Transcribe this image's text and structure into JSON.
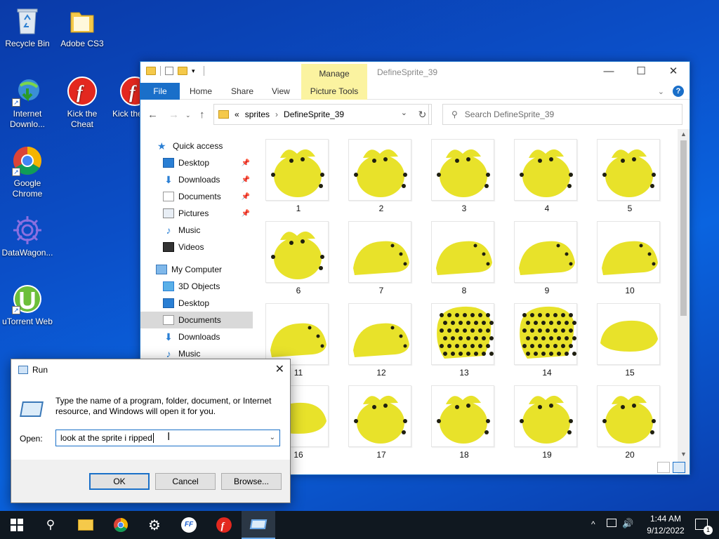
{
  "desktop": {
    "icons": [
      {
        "label": "Recycle Bin",
        "icon": "recycle-bin-icon"
      },
      {
        "label": "Adobe CS3",
        "icon": "folder-icon"
      },
      {
        "label": "Internet Downlo...",
        "icon": "internet-download-manager-icon"
      },
      {
        "label": "Kick the Cheat",
        "icon": "flash-icon"
      },
      {
        "label": "Kick the Cheat_d...",
        "icon": "flash-icon"
      },
      {
        "label": "Google Chrome",
        "icon": "chrome-icon"
      },
      {
        "label": "DataWagon...",
        "icon": "datawagon-icon"
      },
      {
        "label": "uTorrent Web",
        "icon": "utorrent-icon"
      }
    ]
  },
  "explorer": {
    "title": "DefineSprite_39",
    "manage_label": "Manage",
    "tabs": {
      "file": "File",
      "home": "Home",
      "share": "Share",
      "view": "View",
      "picture_tools": "Picture Tools"
    },
    "address": {
      "prefix": "«",
      "segments": [
        "sprites",
        "DefineSprite_39"
      ],
      "sep": "›"
    },
    "search_placeholder": "Search DefineSprite_39",
    "nav": {
      "quick_access": "Quick access",
      "quick_items": [
        "Desktop",
        "Downloads",
        "Documents",
        "Pictures",
        "Music",
        "Videos"
      ],
      "my_computer": "My Computer",
      "pc_items": [
        "3D Objects",
        "Desktop",
        "Documents",
        "Downloads",
        "Music"
      ]
    },
    "files": [
      "1",
      "2",
      "3",
      "4",
      "5",
      "6",
      "7",
      "8",
      "9",
      "10",
      "11",
      "12",
      "13",
      "14",
      "15",
      "16",
      "17",
      "18",
      "19",
      "20"
    ],
    "colors": {
      "file_tab": "#1a6fc9",
      "contextual": "#fbf3a0",
      "sprite": "#e8e22a",
      "sprite_dark": "#1f1f10"
    }
  },
  "run": {
    "title": "Run",
    "description": "Type the name of a program, folder, document, or Internet resource, and Windows will open it for you.",
    "open_label": "Open:",
    "input_value": "look at the sprite i ripped",
    "ok": "OK",
    "cancel": "Cancel",
    "browse": "Browse..."
  },
  "taskbar": {
    "time": "1:44 AM",
    "date": "9/12/2022",
    "notifications": "1",
    "items": [
      "start-icon",
      "search-icon",
      "file-explorer-icon",
      "chrome-icon",
      "settings-icon",
      "ffdec-icon",
      "flash-icon",
      "run-icon"
    ]
  }
}
